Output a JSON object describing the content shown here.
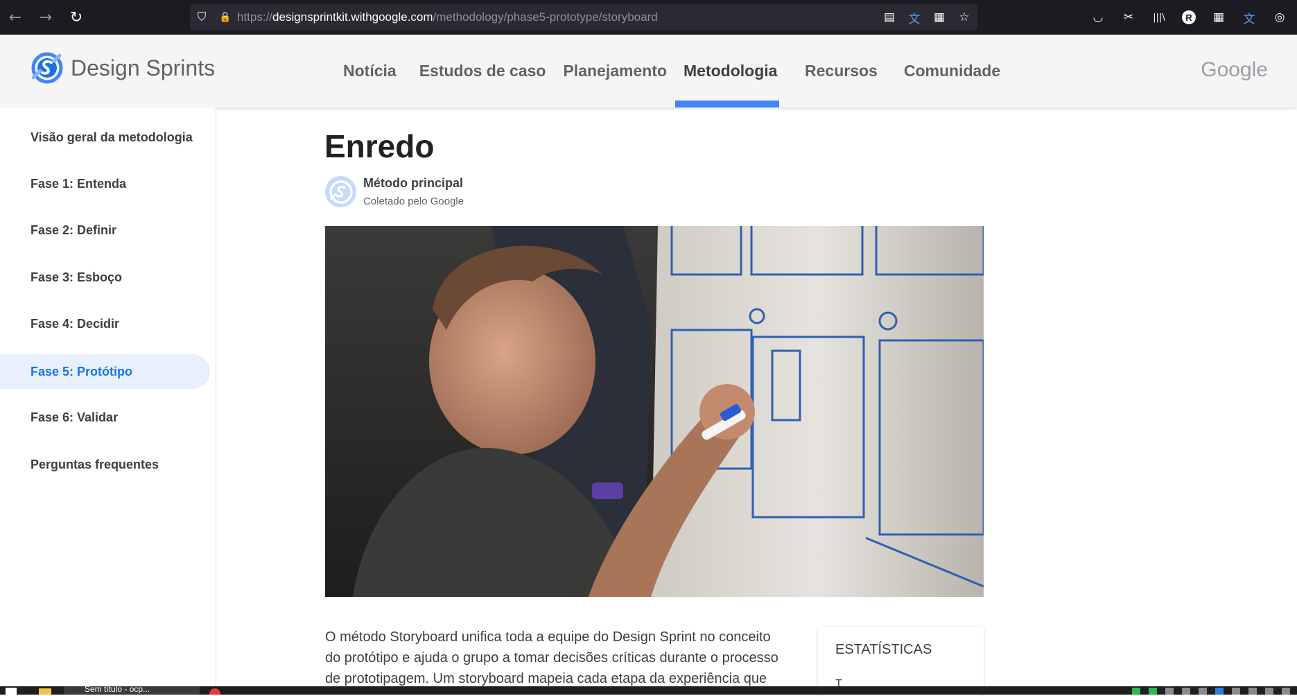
{
  "browser": {
    "back": "←",
    "forward": "→",
    "reload": "↻",
    "shield": "⛉",
    "lock": "🔒",
    "url_prefix": "https://",
    "url_host": "designsprintkit.withgoogle.com",
    "url_path": "/methodology/phase5-prototype/storyboard",
    "reader_icon": "▤",
    "translate_icon": "文",
    "grid_icon": "▦",
    "star_icon": "☆",
    "pocket_icon": "◡",
    "screenshot_icon": "✂",
    "library_icon": "|||\\",
    "profile_initial": "R",
    "extensions_icon": "▦",
    "translate2_icon": "文",
    "container_icon": "◎"
  },
  "site": {
    "logo_text": "Design Sprints",
    "google_word": "Google",
    "nav": [
      "Notícia",
      "Estudos de caso",
      "Planejamento",
      "Metodologia",
      "Recursos",
      "Comunidade"
    ],
    "active_nav_index": 3
  },
  "sidebar": {
    "items": [
      {
        "label": "Visão geral da metodologia"
      },
      {
        "label": "Fase 1: Entenda"
      },
      {
        "label": "Fase 2: Definir"
      },
      {
        "label": "Fase 3: Esboço"
      },
      {
        "label": "Fase 4: Decidir"
      },
      {
        "label": "Fase 5: Protótipo"
      },
      {
        "label": "Fase 6: Validar"
      },
      {
        "label": "Perguntas frequentes"
      }
    ],
    "active_index": 5
  },
  "article": {
    "title": "Enredo",
    "author_name": "Método principal",
    "author_sub": "Coletado pelo Google",
    "body_line1": "O método Storyboard unifica toda a equipe do Design Sprint no conceito",
    "body_line2": "do protótipo e ajuda o grupo a tomar decisões críticas durante o processo",
    "body_line3": "de prototipagem. Um storyboard mapeia cada etapa da experiência que",
    "stats_title": "ESTATÍSTICAS",
    "stats_sub": "T"
  },
  "taskbar": {
    "task_label": "Sem título - ocp..."
  },
  "colors": {
    "accent": "#4285f4",
    "active_side_bg": "#e8f0fe",
    "active_side_text": "#1a73e8",
    "browser_bg": "#1c1b22"
  }
}
